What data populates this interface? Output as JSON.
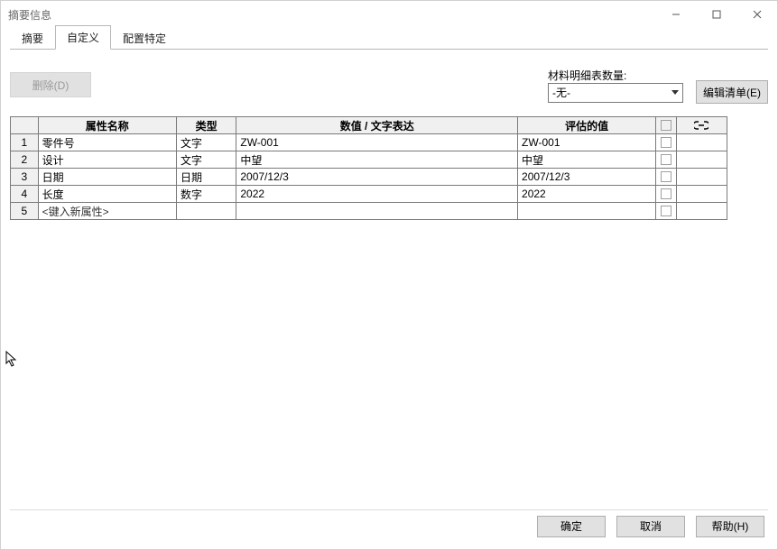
{
  "window_title": "摘要信息",
  "tabs": {
    "summary": "摘要",
    "custom": "自定义",
    "config": "配置特定"
  },
  "active_tab": "custom",
  "buttons": {
    "delete": "删除(D)",
    "edit_list": "编辑清单(E)",
    "ok": "确定",
    "cancel": "取消",
    "help": "帮助(H)"
  },
  "bom": {
    "label": "材料明细表数量:",
    "selected": "-无-"
  },
  "grid": {
    "headers": {
      "attr": "属性名称",
      "type": "类型",
      "value": "数值 / 文字表达",
      "eval": "评估的值"
    },
    "link_icon_name": "link-icon",
    "rows": [
      {
        "idx": "1",
        "attr": "零件号",
        "type": "文字",
        "value": " ZW-001",
        "eval": " ZW-001"
      },
      {
        "idx": "2",
        "attr": "设计",
        "type": "文字",
        "value": "中望",
        "eval": "中望"
      },
      {
        "idx": "3",
        "attr": "日期",
        "type": "日期",
        "value": "2007/12/3",
        "eval": "2007/12/3"
      },
      {
        "idx": "4",
        "attr": "长度",
        "type": "数字",
        "value": "2022",
        "eval": "2022"
      }
    ],
    "new_row": {
      "idx": "5",
      "placeholder": "<键入新属性>"
    }
  }
}
